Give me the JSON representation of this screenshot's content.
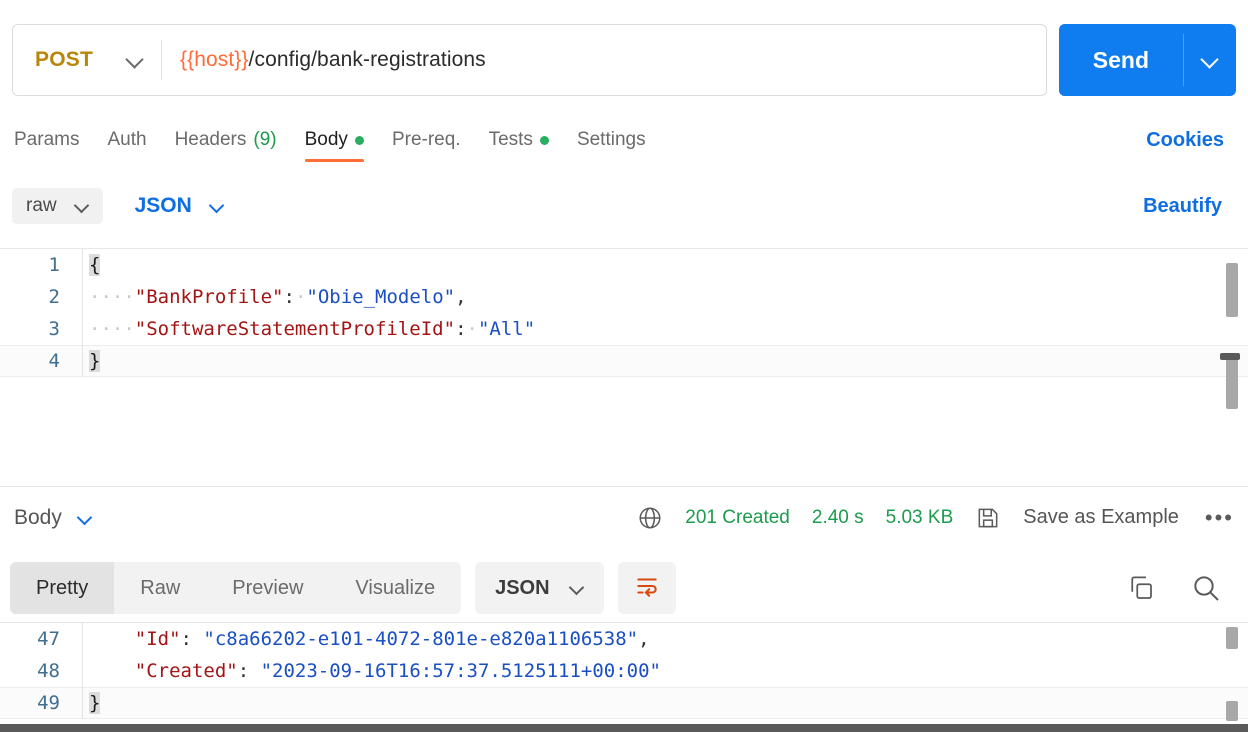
{
  "request": {
    "method": "POST",
    "method_chevron_icon": "chevron-down-icon",
    "url_variable": "{{host}}",
    "url_path": "/config/bank-registrations",
    "send_label": "Send",
    "send_chevron_icon": "chevron-down-icon",
    "accent_blue": "#0f7df0",
    "method_color": "#b8860b",
    "variable_color": "#ff6c37",
    "tabs": [
      {
        "label": "Params",
        "count": "",
        "dot": false,
        "active": false
      },
      {
        "label": "Auth",
        "count": "",
        "dot": false,
        "active": false
      },
      {
        "label": "Headers",
        "count": "(9)",
        "dot": false,
        "active": false
      },
      {
        "label": "Body",
        "count": "",
        "dot": true,
        "active": true
      },
      {
        "label": "Pre-req.",
        "count": "",
        "dot": false,
        "active": false
      },
      {
        "label": "Tests",
        "count": "",
        "dot": true,
        "active": false
      },
      {
        "label": "Settings",
        "count": "",
        "dot": false,
        "active": false
      }
    ],
    "cookies_label": "Cookies",
    "body_mode": "raw",
    "body_format": "JSON",
    "beautify_label": "Beautify",
    "underline_color": "#ff6c37",
    "dot_color": "#27ae60",
    "count_color": "#1a9c4c"
  },
  "request_code": {
    "lines": [
      {
        "num": "1",
        "active": false,
        "tokens": [
          {
            "t": "{",
            "c": "brk"
          }
        ]
      },
      {
        "num": "2",
        "active": false,
        "tokens": [
          {
            "t": "····",
            "c": "ws"
          },
          {
            "t": "\"BankProfile\"",
            "c": "k"
          },
          {
            "t": ":",
            "c": "p"
          },
          {
            "t": "·",
            "c": "ws"
          },
          {
            "t": "\"Obie_Modelo\"",
            "c": "v"
          },
          {
            "t": ",",
            "c": "p"
          }
        ]
      },
      {
        "num": "3",
        "active": false,
        "tokens": [
          {
            "t": "····",
            "c": "ws"
          },
          {
            "t": "\"SoftwareStatementProfileId\"",
            "c": "k"
          },
          {
            "t": ":",
            "c": "p"
          },
          {
            "t": "·",
            "c": "ws"
          },
          {
            "t": "\"All\"",
            "c": "v"
          }
        ]
      },
      {
        "num": "4",
        "active": true,
        "tokens": [
          {
            "t": "}",
            "c": "brk"
          }
        ]
      }
    ]
  },
  "response": {
    "body_label": "Body",
    "body_chevron_icon": "chevron-down-icon",
    "globe_icon": "globe-icon",
    "status": "201 Created",
    "time": "2.40 s",
    "size": "5.03 KB",
    "save_icon": "floppy-save-icon",
    "save_label": "Save as Example",
    "more_icon": "ellipsis-horizontal-icon",
    "status_color": "#1a9c4c",
    "view_tabs": [
      {
        "label": "Pretty",
        "active": true
      },
      {
        "label": "Raw",
        "active": false
      },
      {
        "label": "Preview",
        "active": false
      },
      {
        "label": "Visualize",
        "active": false
      }
    ],
    "format": "JSON",
    "format_chevron_icon": "chevron-down-icon",
    "wrap_icon": "word-wrap-icon",
    "wrap_icon_color": "#d9480f",
    "copy_icon": "copy-icon",
    "search_icon": "search-icon"
  },
  "response_code": {
    "lines": [
      {
        "num": "47",
        "active": false,
        "tokens": [
          {
            "t": "    ",
            "c": "p"
          },
          {
            "t": "\"Id\"",
            "c": "k"
          },
          {
            "t": ": ",
            "c": "p"
          },
          {
            "t": "\"c8a66202-e101-4072-801e-e820a1106538\"",
            "c": "v"
          },
          {
            "t": ",",
            "c": "p"
          }
        ]
      },
      {
        "num": "48",
        "active": false,
        "tokens": [
          {
            "t": "    ",
            "c": "p"
          },
          {
            "t": "\"Created\"",
            "c": "k"
          },
          {
            "t": ": ",
            "c": "p"
          },
          {
            "t": "\"2023-09-16T16:57:37.5125111+00:00\"",
            "c": "v"
          }
        ]
      },
      {
        "num": "49",
        "active": true,
        "tokens": [
          {
            "t": "}",
            "c": "brk"
          }
        ]
      }
    ]
  }
}
